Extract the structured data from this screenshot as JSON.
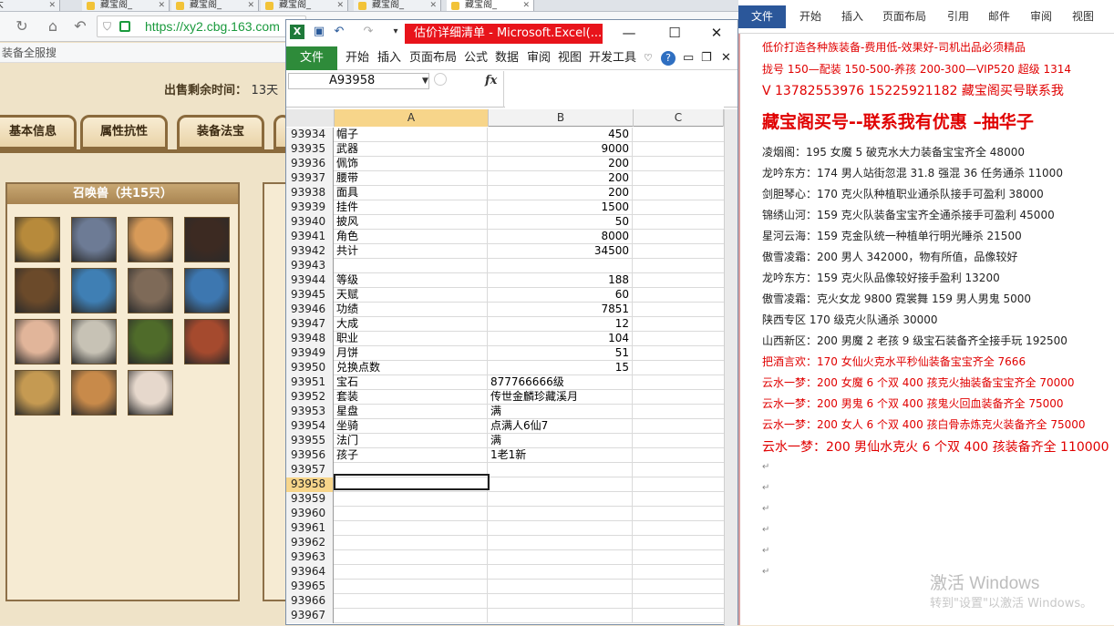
{
  "browser": {
    "tabs": [
      "(大",
      "藏宝阁_",
      "藏宝阁_",
      "藏宝阁_",
      "藏宝阁_",
      "藏宝阁_"
    ],
    "url": "https://xy2.cbg.163.com",
    "bookmark_text": "装备全服搜"
  },
  "game": {
    "sell_label": "出售剩余时间：",
    "sell_value": "13天",
    "tabs": [
      "基本信息",
      "属性抗性",
      "装备法宝"
    ],
    "pet_panel_title": "召唤兽（共15只）",
    "pet_colors": [
      "#b78a3b",
      "#6d7b95",
      "#d79a58",
      "#3c2a22",
      "#6b4a2a",
      "#3f7fb4",
      "#7e6a58",
      "#3d77b0",
      "#e1b59a",
      "#c7c2b5",
      "#4f6b2a",
      "#a54a2e",
      "#c59a52",
      "#c88a4a",
      "#e6d8cc"
    ]
  },
  "excel": {
    "title": "估价详细清单 - Microsoft.Excel(...",
    "file_tab": "文件",
    "ribbon_tabs": [
      "开始",
      "插入",
      "页面布局",
      "公式",
      "数据",
      "审阅",
      "视图",
      "开发工具"
    ],
    "name_box": "A93958",
    "fx": "fx",
    "columns": [
      "A",
      "B",
      "C"
    ],
    "rows": [
      {
        "n": "93934",
        "a": "帽子",
        "b": "450",
        "t": "num"
      },
      {
        "n": "93935",
        "a": "武器",
        "b": "9000",
        "t": "num"
      },
      {
        "n": "93936",
        "a": "佩饰",
        "b": "200",
        "t": "num"
      },
      {
        "n": "93937",
        "a": "腰带",
        "b": "200",
        "t": "num"
      },
      {
        "n": "93938",
        "a": "面具",
        "b": "200",
        "t": "num"
      },
      {
        "n": "93939",
        "a": "挂件",
        "b": "1500",
        "t": "num"
      },
      {
        "n": "93940",
        "a": "披风",
        "b": "50",
        "t": "num"
      },
      {
        "n": "93941",
        "a": "角色",
        "b": "8000",
        "t": "num"
      },
      {
        "n": "93942",
        "a": "共计",
        "b": "34500",
        "t": "num"
      },
      {
        "n": "93943",
        "a": "",
        "b": "",
        "t": "num"
      },
      {
        "n": "93944",
        "a": "等级",
        "b": "188",
        "t": "num"
      },
      {
        "n": "93945",
        "a": "天赋",
        "b": "60",
        "t": "num"
      },
      {
        "n": "93946",
        "a": "功绩",
        "b": "7851",
        "t": "num"
      },
      {
        "n": "93947",
        "a": "大成",
        "b": "12",
        "t": "num"
      },
      {
        "n": "93948",
        "a": "职业",
        "b": "104",
        "t": "num"
      },
      {
        "n": "93949",
        "a": "月饼",
        "b": "51",
        "t": "num"
      },
      {
        "n": "93950",
        "a": "兑换点数",
        "b": "15",
        "t": "num"
      },
      {
        "n": "93951",
        "a": "宝石",
        "b": "877766666级",
        "t": "txt"
      },
      {
        "n": "93952",
        "a": "套装",
        "b": "传世金麟珍藏溪月",
        "t": "txt"
      },
      {
        "n": "93953",
        "a": "星盘",
        "b": "满",
        "t": "txt"
      },
      {
        "n": "93954",
        "a": "坐骑",
        "b": "点满人6仙7",
        "t": "txt"
      },
      {
        "n": "93955",
        "a": "法门",
        "b": "满",
        "t": "txt"
      },
      {
        "n": "93956",
        "a": "孩子",
        "b": "1老1新",
        "t": "txt"
      },
      {
        "n": "93957",
        "a": "",
        "b": "",
        "t": "txt"
      },
      {
        "n": "93958",
        "a": "",
        "b": "",
        "t": "txt"
      },
      {
        "n": "93959",
        "a": "",
        "b": "",
        "t": "txt"
      },
      {
        "n": "93960",
        "a": "",
        "b": "",
        "t": "txt"
      },
      {
        "n": "93961",
        "a": "",
        "b": "",
        "t": "txt"
      },
      {
        "n": "93962",
        "a": "",
        "b": "",
        "t": "txt"
      },
      {
        "n": "93963",
        "a": "",
        "b": "",
        "t": "txt"
      },
      {
        "n": "93964",
        "a": "",
        "b": "",
        "t": "txt"
      },
      {
        "n": "93965",
        "a": "",
        "b": "",
        "t": "txt"
      },
      {
        "n": "93966",
        "a": "",
        "b": "",
        "t": "txt"
      },
      {
        "n": "93967",
        "a": "",
        "b": "",
        "t": "txt"
      }
    ]
  },
  "word": {
    "file_tab": "文件",
    "ribbon_tabs": [
      "开始",
      "插入",
      "页面布局",
      "引用",
      "邮件",
      "审阅",
      "视图"
    ],
    "lines": [
      {
        "text": "低价打造各种族装备-费用低-效果好-司机出品必须精品",
        "style": "red"
      },
      {
        "text": "拢号 150—配装 150-500-养孩 200-300—VIP520 超级 1314",
        "style": "red"
      },
      {
        "text": "V 13782553976    15225921182  藏宝阁买号联系我",
        "style": "red big"
      },
      {
        "text": "藏宝阁买号--联系我有优惠 –抽华子",
        "style": "red huge"
      },
      {
        "text": "凌烟阁：195 女魔 5 破克水大力装备宝宝齐全 48000",
        "style": ""
      },
      {
        "text": "龙吟东方：174 男人站街忽混 31.8 强混 36 任务通杀 11000",
        "style": ""
      },
      {
        "text": "剑胆琴心：170 克火队种植职业通杀队接手可盈利 38000",
        "style": ""
      },
      {
        "text": "锦绣山河：159 克火队装备宝宝齐全通杀接手可盈利 45000",
        "style": ""
      },
      {
        "text": "星河云海：159 克金队统一种植单行明光睡杀 21500",
        "style": ""
      },
      {
        "text": "傲雪凌霜：200 男人 342000，物有所值，品像较好",
        "style": ""
      },
      {
        "text": "龙吟东方：159 克火队品像较好接手盈利 13200",
        "style": ""
      },
      {
        "text": "傲雪凌霜：克火女龙 9800    霓裳舞 159 男人男鬼 5000",
        "style": ""
      },
      {
        "text": "陕西专区 170 级克火队通杀 30000",
        "style": ""
      },
      {
        "text": "山西新区：200 男魔 2 老孩 9 级宝石装备齐全接手玩 192500",
        "style": ""
      },
      {
        "text": "把酒言欢：170 女仙火克水平秒仙装备宝宝齐全 7666",
        "style": "red"
      },
      {
        "text": "云水一梦：200 女魔 6 个双 400 孩克火抽装备宝宝齐全 70000",
        "style": "red"
      },
      {
        "text": "云水一梦：200 男鬼 6 个双 400 孩鬼火回血装备齐全 75000",
        "style": "red"
      },
      {
        "text": "云水一梦：200 女人 6 个双 400 孩白骨赤炼克火装备齐全 75000",
        "style": "red"
      },
      {
        "text": "云水一梦：200 男仙水克火 6 个双 400 孩装备齐全 110000",
        "style": "red big"
      }
    ],
    "watermark_title": "激活 Windows",
    "watermark_sub": "转到\"设置\"以激活 Windows。"
  }
}
